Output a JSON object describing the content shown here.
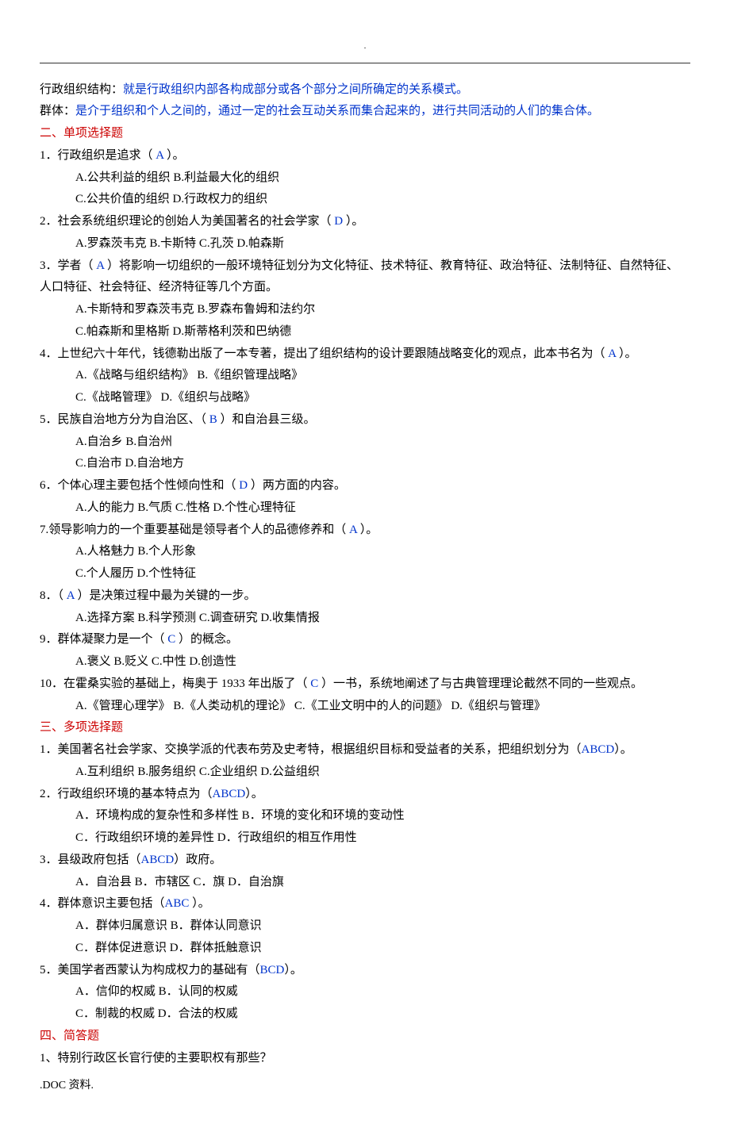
{
  "header_dot": ".",
  "def1": {
    "label": "行政组织结构：",
    "text": "就是行政组织内部各构成部分或各个部分之间所确定的关系模式。"
  },
  "def2": {
    "label": "群体：",
    "text": "是介于组织和个人之间的，通过一定的社会互动关系而集合起来的，进行共同活动的人们的集合体。"
  },
  "sec2": "二、单项选择题",
  "q1": {
    "stem_a": "1．行政组织是追求（ ",
    "ans": "A",
    "stem_b": " ）。",
    "opts1": "A.公共利益的组织    B.利益最大化的组织",
    "opts2": "C.公共价值的组织   D.行政权力的组织"
  },
  "q2": {
    "stem_a": "2．社会系统组织理论的创始人为美国著名的社会学家（ ",
    "ans": "D",
    "stem_b": " ）。",
    "opts": "A.罗森茨韦克    B.卡斯特   C.孔茨   D.帕森斯"
  },
  "q3": {
    "stem_a": "3．学者（ ",
    "ans": "A",
    "stem_b": " ）将影响一切组织的一般环境特征划分为文化特征、技术特征、教育特征、政治特征、法制特征、自然特征、人口特征、社会特征、经济特征等几个方面。",
    "opts1": "A.卡斯特和罗森茨韦克    B.罗森布鲁姆和法约尔",
    "opts2": "C.帕森斯和里格斯    D.斯蒂格利茨和巴纳德"
  },
  "q4": {
    "stem_a": "4．上世纪六十年代，钱德勒出版了一本专著，提出了组织结构的设计要跟随战略变化的观点，此本书名为（ ",
    "ans": "A",
    "stem_b": " ）。",
    "opts1": "A.《战略与组织结构》    B.《组织管理战略》",
    "opts2": "C.《战略管理》   D.《组织与战略》"
  },
  "q5": {
    "stem_a": "5．民族自治地方分为自治区、（ ",
    "ans": "B",
    "stem_b": " ）和自治县三级。",
    "opts1": "A.自治乡    B.自治州",
    "opts2": "C.自治市    D.自治地方"
  },
  "q6": {
    "stem_a": "6．个体心理主要包括个性倾向性和（ ",
    "ans": "D",
    "stem_b": " ）两方面的内容。",
    "opts": "A.人的能力  B.气质  C.性格  D.个性心理特征"
  },
  "q7": {
    "stem_a": "7.领导影响力的一个重要基础是领导者个人的品德修养和（ ",
    "ans": "A",
    "stem_b": " ）。",
    "opts1": "A.人格魅力  B.个人形象",
    "opts2": "C.个人履历  D.个性特征"
  },
  "q8": {
    "stem_a": "8．（ ",
    "ans": "A",
    "stem_b": " ）是决策过程中最为关键的一步。",
    "opts": "A.选择方案  B.科学预测  C.调查研究  D.收集情报"
  },
  "q9": {
    "stem_a": "9．群体凝聚力是一个（ ",
    "ans": "C",
    "stem_b": " ）的概念。",
    "opts": "A.褒义  B.贬义  C.中性  D.创造性"
  },
  "q10": {
    "stem_a": "10．在霍桑实验的基础上，梅奥于 1933 年出版了（ ",
    "ans": "C",
    "stem_b": " ）一书，系统地阐述了与古典管理理论截然不同的一些观点。",
    "opts": "A.《管理心理学》     B.《人类动机的理论》  C.《工业文明中的人的问题》     D.《组织与管理》"
  },
  "sec3": "三、多项选择题",
  "m1": {
    "stem_a": "1．美国著名社会学家、交换学派的代表布劳及史考特，根据组织目标和受益者的关系，把组织划分为（",
    "ans": "ABCD",
    "stem_b": "）。",
    "opts": "A.互利组织  B.服务组织  C.企业组织  D.公益组织"
  },
  "m2": {
    "stem_a": "2．行政组织环境的基本特点为（",
    "ans": "ABCD",
    "stem_b": "）。",
    "opts1": "A．环境构成的复杂性和多样性    B．环境的变化和环境的变动性",
    "opts2": "C．行政组织环境的差异性    D．行政组织的相互作用性"
  },
  "m3": {
    "stem_a": "3．县级政府包括（",
    "ans": "ABCD",
    "stem_b": "）政府。",
    "opts": "A．自治县   B．市辖区   C．旗   D．自治旗"
  },
  "m4": {
    "stem_a": "4．群体意识主要包括（",
    "ans": "ABC",
    "stem_b": " ）。",
    "opts1": "A．群体归属意识    B．群体认同意识",
    "opts2": "C．群体促进意识    D．群体抵触意识"
  },
  "m5": {
    "stem_a": "5．美国学者西蒙认为构成权力的基础有（",
    "ans": "BCD",
    "stem_b": "）。",
    "opts1": "A．信仰的权威   B．认同的权威",
    "opts2": "C．制裁的权威   D．合法的权威"
  },
  "sec4": "四、简答题",
  "sa1": "1、特别行政区长官行使的主要职权有那些？",
  "footer": ".DOC 资料."
}
